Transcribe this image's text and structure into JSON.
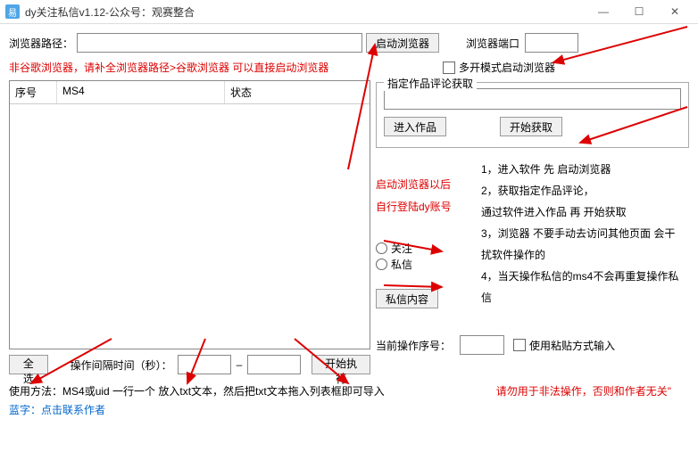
{
  "titlebar": {
    "icon_letter": "易",
    "title": "dy关注私信v1.12-公众号：观赛整合"
  },
  "browser": {
    "path_label": "浏览器路径：",
    "path_value": "",
    "launch_btn": "启动浏览器",
    "port_label": "浏览器端口",
    "port_value": ""
  },
  "notes": {
    "non_chrome": "非谷歌浏览器，请补全浏览器路径>谷歌浏览器 可以直接启动浏览器",
    "multi_open": "多开模式启动浏览器",
    "after_launch_1": "启动浏览器以后",
    "after_launch_2": "自行登陆dy账号",
    "usage_prefix": "使用方法：",
    "usage_rest": "MS4或uid 一行一个 放入txt文本，然后把txt文本拖入列表框即可导入",
    "blue_prefix": "蓝字：",
    "blue_link": "点击联系作者",
    "warning": "请勿用于非法操作，否则和作者无关\""
  },
  "table": {
    "col1": "序号",
    "col2": "MS4",
    "col3": "状态"
  },
  "comment_fetch": {
    "group_title": "指定作品评论获取",
    "input_value": "",
    "enter_btn": "进入作品",
    "start_btn": "开始获取"
  },
  "radios": {
    "follow": "关注",
    "dm": "私信"
  },
  "dm_content_btn": "私信内容",
  "instructions": {
    "i1": "1，进入软件 先 启动浏览器",
    "i2": "2，获取指定作品评论，",
    "i2b": "通过软件进入作品 再 开始获取",
    "i3": "3，浏览器 不要手动去访问其他页面 会干",
    "i3b": "扰软件操作的",
    "i4": "4，当天操作私信的ms4不会再重复操作私信"
  },
  "current_op": {
    "label": "当前操作序号：",
    "value": "",
    "paste_label": "使用粘贴方式输入"
  },
  "bottom": {
    "select_all": "全选",
    "interval_label": "操作间隔时间（秒）：",
    "interval_from": "",
    "interval_to": "",
    "start_exec": "开始执行"
  }
}
